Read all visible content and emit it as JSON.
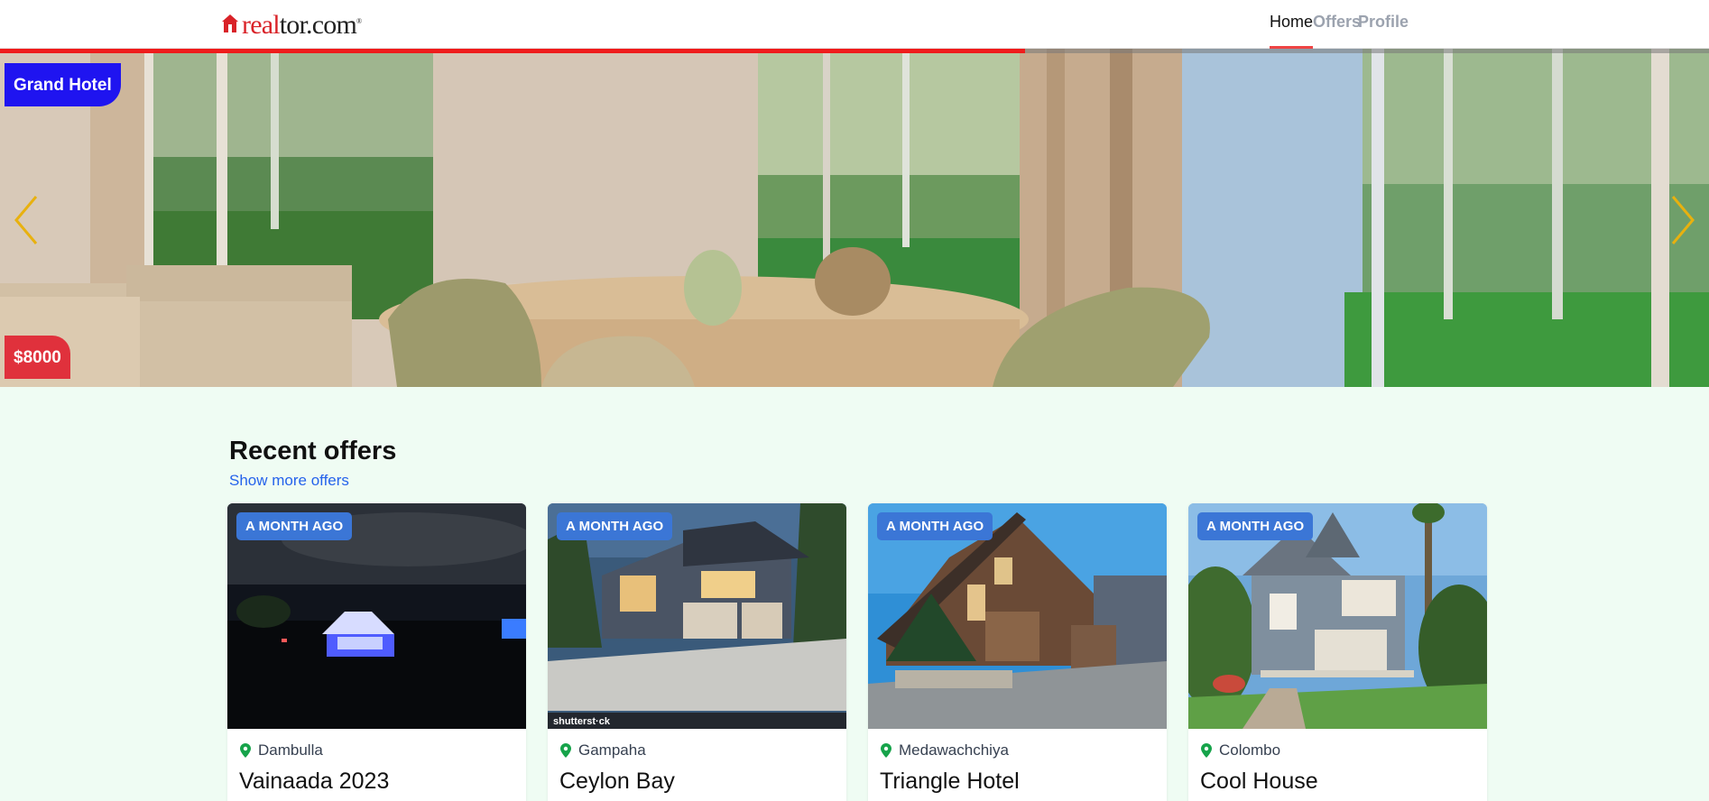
{
  "header": {
    "logo": {
      "part_red": "real",
      "part_dark": "tor.com",
      "brand_color": "#d92228"
    },
    "nav": [
      {
        "label": "Home",
        "active": true
      },
      {
        "label": "Offers",
        "active": false
      },
      {
        "label": "Profile",
        "active": false
      }
    ]
  },
  "hero": {
    "listing_name": "Grand Hotel",
    "price": "$8000",
    "slide_progress": 0.6,
    "colors": {
      "name_badge": "#1f14f0",
      "price_badge": "#e0313c",
      "progress": "#ef1c1c",
      "arrows": "#e8b10f"
    }
  },
  "recent": {
    "title": "Recent offers",
    "show_more": "Show more offers",
    "cards": [
      {
        "time": "A MONTH AGO",
        "location": "Dambulla",
        "name": "Vainaada 2023"
      },
      {
        "time": "A MONTH AGO",
        "location": "Gampaha",
        "name": "Ceylon Bay",
        "watermark": "shutterst·ck"
      },
      {
        "time": "A MONTH AGO",
        "location": "Medawachchiya",
        "name": "Triangle Hotel"
      },
      {
        "time": "A MONTH AGO",
        "location": "Colombo",
        "name": "Cool House"
      }
    ],
    "colors": {
      "time_badge": "#3b76d6",
      "pin": "#16a34a",
      "link": "#2563eb"
    }
  }
}
